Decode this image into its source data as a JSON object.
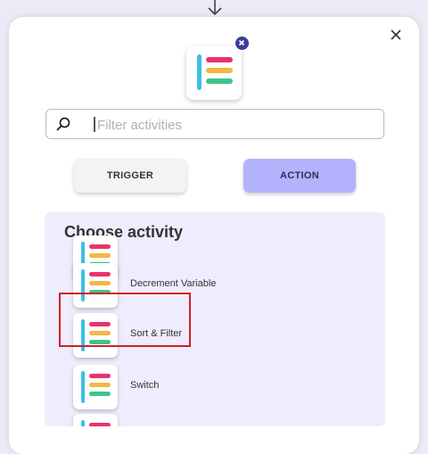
{
  "colors": {
    "background": "#ebebf5",
    "accent_action": "#b4b2fc",
    "trigger_bg": "#f3f3f5",
    "panel_bg": "#eeedfd",
    "badge": "#3b3c9a",
    "highlight": "#d0202a",
    "icon_bar_cyan": "#3dc0e6",
    "icon_bar_pink": "#e9336a",
    "icon_bar_yellow": "#f2b843",
    "icon_bar_green": "#3ec58a"
  },
  "icons": {
    "top": "arrow-down-icon",
    "close": "close-icon",
    "app": "list-app-icon",
    "badge": "remove-x-icon",
    "search": "search-icon"
  },
  "search": {
    "placeholder": "Filter activities",
    "value": ""
  },
  "segments": {
    "trigger": "TRIGGER",
    "action": "ACTION",
    "selected": "ACTION"
  },
  "panel": {
    "title": "Choose activity",
    "items": [
      {
        "label": ""
      },
      {
        "label": "Decrement Variable"
      },
      {
        "label": "Sort & Filter"
      },
      {
        "label": "Switch"
      },
      {
        "label": ""
      }
    ]
  }
}
